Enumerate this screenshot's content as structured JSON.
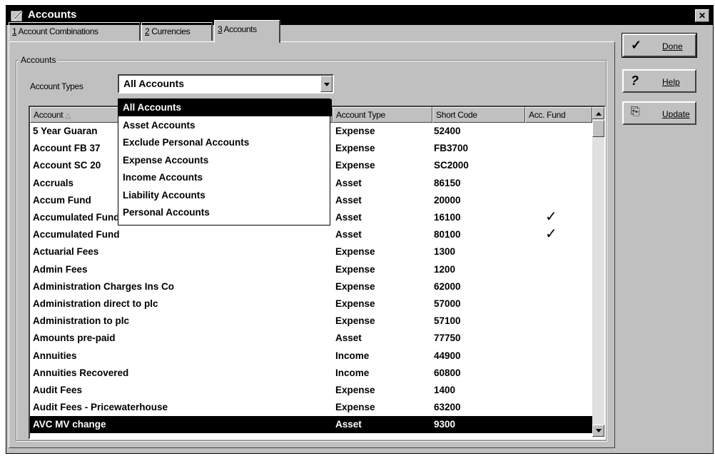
{
  "window": {
    "title": "Accounts",
    "close_glyph": "✕"
  },
  "tabs": [
    {
      "num": "1",
      "label": " Account Combinations"
    },
    {
      "num": "2",
      "label": " Currencies"
    },
    {
      "num": "3",
      "label": " Accounts"
    }
  ],
  "group": {
    "label": "Accounts"
  },
  "filter": {
    "label": "Account Types",
    "selected": "All Accounts",
    "options": [
      "All Accounts",
      "Asset Accounts",
      "Exclude Personal Accounts",
      "Expense Accounts",
      "Income Accounts",
      "Liability Accounts",
      "Personal Accounts"
    ]
  },
  "table": {
    "columns": [
      "Account",
      "Account Type",
      "Short Code",
      "Acc. Fund"
    ],
    "sort_glyph": "△",
    "rows": [
      {
        "name": "5 Year Guaran",
        "type": "Expense",
        "code": "52400",
        "fund": false
      },
      {
        "name": "Account FB 37",
        "type": "Expense",
        "code": "FB3700",
        "fund": false
      },
      {
        "name": "Account SC 20",
        "type": "Expense",
        "code": "SC2000",
        "fund": false
      },
      {
        "name": "Accruals",
        "type": "Asset",
        "code": "86150",
        "fund": false
      },
      {
        "name": "Accum Fund",
        "type": "Asset",
        "code": "20000",
        "fund": false
      },
      {
        "name": "Accumulated Fund",
        "type": "Asset",
        "code": "16100",
        "fund": true
      },
      {
        "name": "Accumulated Fund",
        "type": "Asset",
        "code": "80100",
        "fund": true
      },
      {
        "name": "Actuarial Fees",
        "type": "Expense",
        "code": "1300",
        "fund": false
      },
      {
        "name": "Admin Fees",
        "type": "Expense",
        "code": "1200",
        "fund": false
      },
      {
        "name": "Administration Charges Ins Co",
        "type": "Expense",
        "code": "62000",
        "fund": false
      },
      {
        "name": "Administration direct to plc",
        "type": "Expense",
        "code": "57000",
        "fund": false
      },
      {
        "name": "Administration to plc",
        "type": "Expense",
        "code": "57100",
        "fund": false
      },
      {
        "name": "Amounts pre-paid",
        "type": "Asset",
        "code": "77750",
        "fund": false
      },
      {
        "name": "Annuities",
        "type": "Income",
        "code": "44900",
        "fund": false
      },
      {
        "name": "Annuities Recovered",
        "type": "Income",
        "code": "60800",
        "fund": false
      },
      {
        "name": "Audit Fees",
        "type": "Expense",
        "code": "1400",
        "fund": false
      },
      {
        "name": "Audit Fees - Pricewaterhouse",
        "type": "Expense",
        "code": "63200",
        "fund": false
      },
      {
        "name": "AVC MV change",
        "type": "Asset",
        "code": "9300",
        "fund": false,
        "selected": true
      }
    ]
  },
  "buttons": {
    "done": {
      "icon": "✓",
      "label": "Done"
    },
    "help": {
      "icon": "?",
      "label": "Help"
    },
    "update": {
      "icon": "⎘",
      "label": "Update"
    }
  }
}
